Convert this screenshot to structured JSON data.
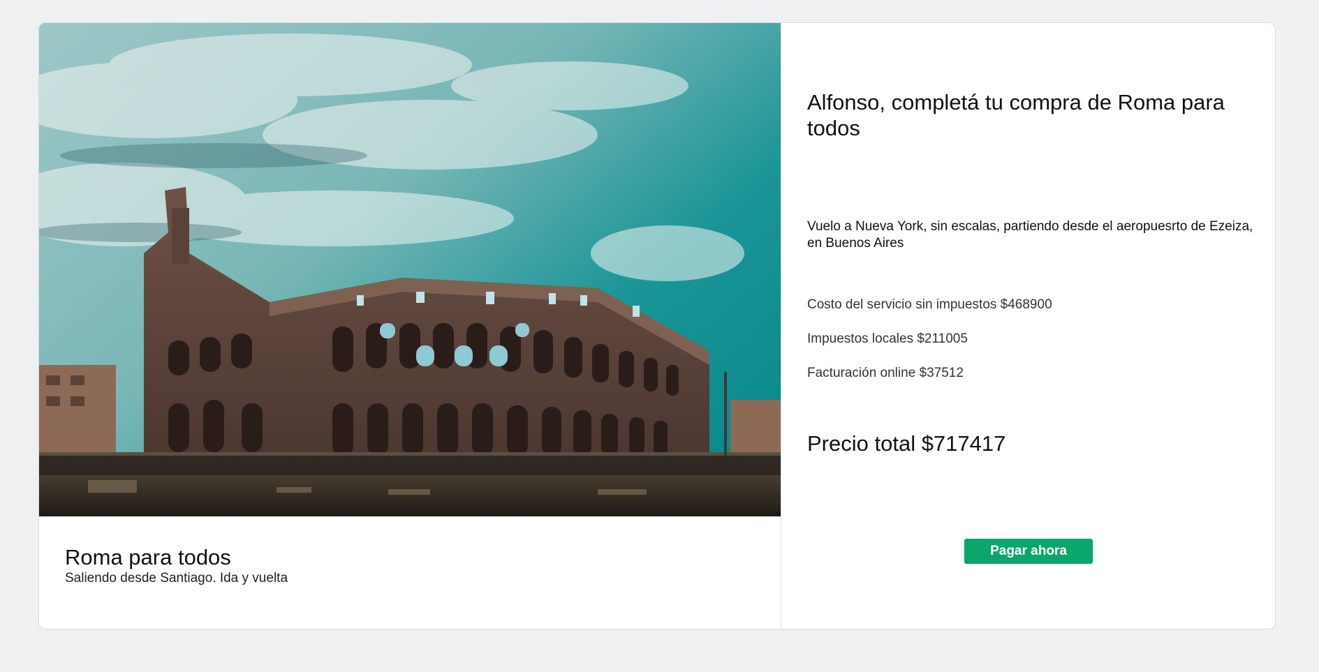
{
  "product": {
    "title": "Roma para todos",
    "subtitle": "Saliendo desde Santiago. Ida y vuelta",
    "image_icon": "colosseum-photo"
  },
  "checkout": {
    "headline": "Alfonso, completá tu compra de Roma para todos",
    "flight_description": "Vuelo a Nueva York, sin escalas, partiendo desde el aeropuesrto de Ezeiza, en Buenos Aires",
    "costs": [
      {
        "label": "Costo del servicio sin impuestos $468900"
      },
      {
        "label": "Impuestos locales $211005"
      },
      {
        "label": "Facturación online $37512"
      }
    ],
    "total": "Precio total $717417",
    "pay_button_label": "Pagar ahora"
  },
  "colors": {
    "background": "#eef0f2",
    "card": "#ffffff",
    "button": "#0aa66b"
  }
}
